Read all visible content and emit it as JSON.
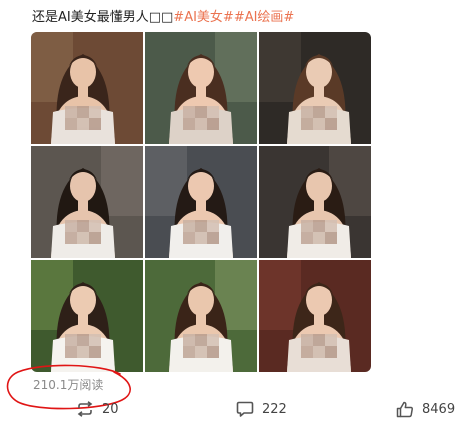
{
  "post": {
    "text": "还是AI美女最懂男人□□",
    "hashtags": [
      "#AI美女#",
      "#AI绘画#"
    ]
  },
  "images": [
    {
      "label": "photo-1",
      "bg": "#6d4a35",
      "wall": "#8a6a4e",
      "skin": "#e8c3a8",
      "hair": "#3a251b",
      "dress": "#e9e2dc"
    },
    {
      "label": "photo-2",
      "bg": "#4c5a4a",
      "wall": "#6f7d68",
      "skin": "#eec9b0",
      "hair": "#4a2e20",
      "dress": "#ddd2c8"
    },
    {
      "label": "photo-3",
      "bg": "#2e2a26",
      "wall": "#4a423a",
      "skin": "#eacbb4",
      "hair": "#5a3a27",
      "dress": "#e5dbd0"
    },
    {
      "label": "photo-4",
      "bg": "#5c5650",
      "wall": "#7a726a",
      "skin": "#e6c4ad",
      "hair": "#211812",
      "dress": "#efece8"
    },
    {
      "label": "photo-5",
      "bg": "#4a4d52",
      "wall": "#6a6d70",
      "skin": "#ecc8b0",
      "hair": "#241a15",
      "dress": "#f1efec"
    },
    {
      "label": "photo-6",
      "bg": "#3a3532",
      "wall": "#5b534c",
      "skin": "#e8c6ae",
      "hair": "#2a1c14",
      "dress": "#f0ece7"
    },
    {
      "label": "photo-7",
      "bg": "#3f5a2e",
      "wall": "#6c8a4a",
      "skin": "#eccbb2",
      "hair": "#2e2018",
      "dress": "#f5f3ef"
    },
    {
      "label": "photo-8",
      "bg": "#4d6a3a",
      "wall": "#7e9460",
      "skin": "#eac7ad",
      "hair": "#3a2418",
      "dress": "#f3f1ec"
    },
    {
      "label": "photo-9",
      "bg": "#5a2a22",
      "wall": "#7a3c30",
      "skin": "#ecc9b1",
      "hair": "#3d2619",
      "dress": "#e8ded6"
    }
  ],
  "stats": {
    "views": "210.1万阅读",
    "reposts": "20",
    "comments": "222",
    "likes": "8469"
  },
  "colors": {
    "hashtag": "#eb7350",
    "annotation": "#e01515",
    "muted": "#8a8a8a"
  },
  "icons": {
    "repost": "repost-icon",
    "comment": "comment-icon",
    "like": "thumbs-up-icon"
  }
}
